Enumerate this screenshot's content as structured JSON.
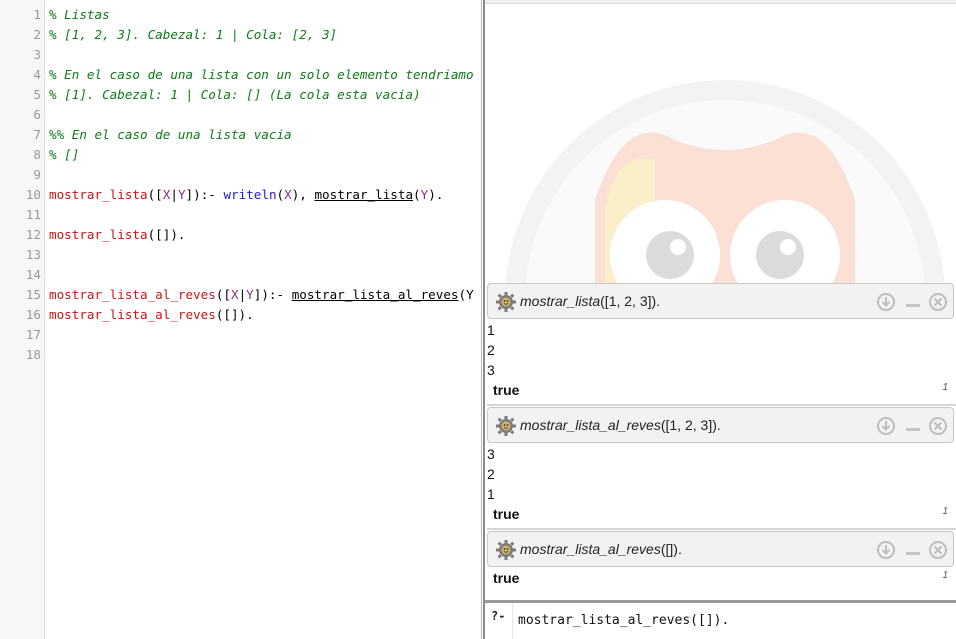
{
  "editor": {
    "lines": [
      {
        "n": "1",
        "parts": [
          {
            "t": "% Listas",
            "c": "comment"
          }
        ]
      },
      {
        "n": "2",
        "parts": [
          {
            "t": "% [1, 2, 3]. Cabezal: 1 | Cola: [2, 3]",
            "c": "comment"
          }
        ]
      },
      {
        "n": "3",
        "parts": []
      },
      {
        "n": "4",
        "parts": [
          {
            "t": "% En el caso de una lista con un solo elemento tendriamo",
            "c": "comment"
          }
        ]
      },
      {
        "n": "5",
        "parts": [
          {
            "t": "% [1]. Cabezal: 1 | Cola: [] (La cola esta vacia)",
            "c": "comment"
          }
        ]
      },
      {
        "n": "6",
        "parts": []
      },
      {
        "n": "7",
        "parts": [
          {
            "t": "%% En el caso de una lista vacia",
            "c": "comment"
          }
        ]
      },
      {
        "n": "8",
        "parts": [
          {
            "t": "% []",
            "c": "comment"
          }
        ]
      },
      {
        "n": "9",
        "parts": []
      },
      {
        "n": "10",
        "parts": [
          {
            "t": "mostrar_lista",
            "c": "pred"
          },
          {
            "t": "([",
            "c": "punct"
          },
          {
            "t": "X",
            "c": "var"
          },
          {
            "t": "|",
            "c": "punct"
          },
          {
            "t": "Y",
            "c": "var"
          },
          {
            "t": "]):- ",
            "c": "punct"
          },
          {
            "t": "writeln",
            "c": "builtin"
          },
          {
            "t": "(",
            "c": "punct"
          },
          {
            "t": "X",
            "c": "var"
          },
          {
            "t": "), ",
            "c": "punct"
          },
          {
            "t": "mostrar_lista",
            "c": "called"
          },
          {
            "t": "(",
            "c": "punct"
          },
          {
            "t": "Y",
            "c": "var"
          },
          {
            "t": ").",
            "c": "punct"
          }
        ]
      },
      {
        "n": "11",
        "parts": []
      },
      {
        "n": "12",
        "parts": [
          {
            "t": "mostrar_lista",
            "c": "pred"
          },
          {
            "t": "([]).",
            "c": "punct"
          }
        ]
      },
      {
        "n": "13",
        "parts": []
      },
      {
        "n": "14",
        "parts": []
      },
      {
        "n": "15",
        "parts": [
          {
            "t": "mostrar_lista_al_reves",
            "c": "pred"
          },
          {
            "t": "([",
            "c": "punct"
          },
          {
            "t": "X",
            "c": "var"
          },
          {
            "t": "|",
            "c": "punct"
          },
          {
            "t": "Y",
            "c": "var"
          },
          {
            "t": "]):- ",
            "c": "punct"
          },
          {
            "t": "mostrar_lista_al_reves",
            "c": "called"
          },
          {
            "t": "(Y",
            "c": "punct"
          }
        ]
      },
      {
        "n": "16",
        "parts": [
          {
            "t": "mostrar_lista_al_reves",
            "c": "pred"
          },
          {
            "t": "([]).",
            "c": "punct"
          }
        ]
      },
      {
        "n": "17",
        "parts": []
      },
      {
        "n": "18",
        "parts": []
      }
    ]
  },
  "runners": [
    {
      "query_name": "mostrar_lista",
      "query_args": "([1, 2, 3]).",
      "output": [
        "1",
        "2",
        "3"
      ],
      "result": "true",
      "solution_index": "1"
    },
    {
      "query_name": "mostrar_lista_al_reves",
      "query_args": "([1, 2, 3]).",
      "output": [
        "3",
        "2",
        "1"
      ],
      "result": "true",
      "solution_index": "1"
    },
    {
      "query_name": "mostrar_lista_al_reves",
      "query_args": "([]).",
      "output": [],
      "result": "true",
      "solution_index": "1"
    }
  ],
  "query": {
    "prompt": "?-",
    "value": "mostrar_lista_al_reves([])."
  }
}
